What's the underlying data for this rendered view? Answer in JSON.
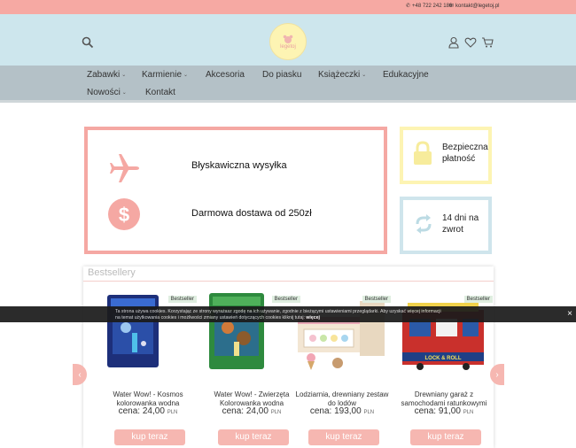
{
  "topbar": {
    "phone": "+48 722 242 186",
    "email": "kontakt@legetoj.pl"
  },
  "logo": {
    "text": "legetoj"
  },
  "colors": {
    "pink": "#f6a9a3",
    "header_blue": "#cde6ed",
    "nav_gray": "#b4c1c7",
    "yellow": "#fdf4b3",
    "light_blue": "#cfe5ec"
  },
  "nav": {
    "items": [
      {
        "label": "Zabawki",
        "has_dropdown": true
      },
      {
        "label": "Karmienie",
        "has_dropdown": true
      },
      {
        "label": "Akcesoria",
        "has_dropdown": false
      },
      {
        "label": "Do piasku",
        "has_dropdown": false
      },
      {
        "label": "Książeczki",
        "has_dropdown": true
      },
      {
        "label": "Edukacyjne",
        "has_dropdown": false
      },
      {
        "label": "Nowości",
        "has_dropdown": true
      },
      {
        "label": "Kontakt",
        "has_dropdown": false
      }
    ]
  },
  "features": {
    "shipping": "Błyskawiczna wysyłka",
    "free_delivery": "Darmowa dostawa od 250zł",
    "secure": "Bezpieczna płatność",
    "returns": "14 dni na zwrot"
  },
  "bestsellers": {
    "title": "Bestsellery",
    "products": [
      {
        "badge": "Bestseller",
        "name": "Water Wow! - Kosmos kolorowanka wodna",
        "price_label": "cena:",
        "price": "24,00",
        "currency": "PLN",
        "button": "kup teraz"
      },
      {
        "badge": "Bestseller",
        "name": "Water Wow! - Zwierzęta Kolorowanka wodna",
        "price_label": "cena:",
        "price": "24,00",
        "currency": "PLN",
        "button": "kup teraz"
      },
      {
        "badge": "Bestseller",
        "name": "Lodziarnia, drewniany zestaw do lodów",
        "price_label": "cena:",
        "price": "193,00",
        "currency": "PLN",
        "button": "kup teraz"
      },
      {
        "badge": "Bestseller",
        "name": "Drewniany garaż z samochodami ratunkowymi",
        "price_label": "cena:",
        "price": "91,00",
        "currency": "PLN",
        "button": "kup teraz"
      }
    ]
  },
  "cookie": {
    "line1": "Ta strona używa cookies. Korzystając ze strony wyrażasz zgodę na ich używanie, zgodnie z bieżącymi ustawieniami przeglądarki. Aby uzyskać więcej informacji",
    "line2": "na temat użytkowania cookies i możliwości zmiany ustawień dotyczących cookies kliknij tutaj:",
    "more": "więcej",
    "close": "×"
  }
}
